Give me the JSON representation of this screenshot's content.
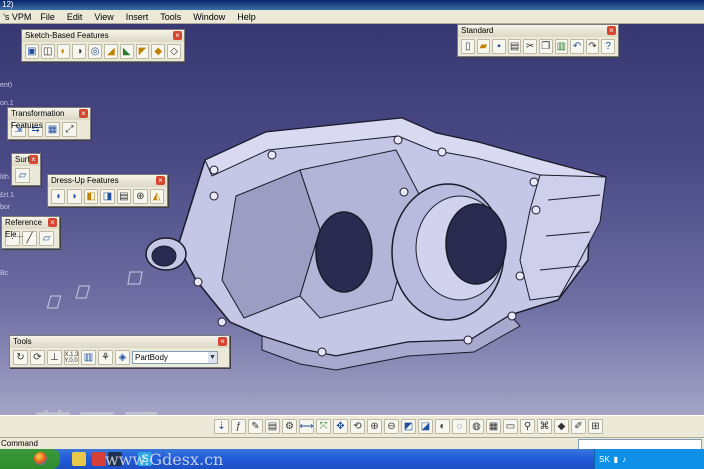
{
  "window": {
    "title_fragment": "12)",
    "app_menu": "’s VPM"
  },
  "menu": [
    "File",
    "Edit",
    "View",
    "Insert",
    "Tools",
    "Window",
    "Help"
  ],
  "toolbars": {
    "sketch": {
      "title": "Sketch-Based Features",
      "icons": [
        "pad-icon",
        "pocket-icon",
        "shaft-icon",
        "groove-icon",
        "hole-icon",
        "rib-icon",
        "slot-icon",
        "stiffener-icon",
        "loft-icon",
        "remove-loft-icon"
      ]
    },
    "standard": {
      "title": "Standard",
      "icons": [
        "new-icon",
        "open-icon",
        "save-icon",
        "print-icon",
        "cut-icon",
        "copy-icon",
        "paste-icon",
        "undo-icon",
        "redo-icon",
        "whats-this-icon"
      ]
    },
    "transformation": {
      "title": "Transformation Features",
      "icons": [
        "translation-icon",
        "mirror-icon",
        "pattern-icon",
        "scaling-icon"
      ]
    },
    "surf": {
      "title": "Surf...",
      "icons": [
        "surface-icon"
      ]
    },
    "dressup": {
      "title": "Dress-Up Features",
      "icons": [
        "fillet-icon",
        "chamfer-icon",
        "draft-icon",
        "shell-icon",
        "thickness-icon",
        "thread-icon",
        "remove-face-icon"
      ]
    },
    "reference": {
      "title": "Reference Ele...",
      "icons": [
        "point-icon",
        "line-icon",
        "plane-icon"
      ]
    },
    "tools": {
      "title": "Tools",
      "icons": [
        "update-icon",
        "swap-visu-icon",
        "axis-system-icon",
        "coordinates-icon",
        "catalog-icon",
        "body-icon",
        "set-icon"
      ],
      "coords_label": "X,1,3\nY,0,0",
      "body_select": "PartBody"
    }
  },
  "tree_labels": [
    "ent)",
    "on.1",
    "lith",
    "£rt.1",
    "bor",
    "Bc"
  ],
  "status": {
    "command_label": "Command",
    "sk_label": "SK"
  },
  "watermark": {
    "text": "莫西网",
    "url": "www.Gdesx.cn"
  },
  "colors": {
    "viewport_top": "#34346e",
    "viewport_bottom": "#c8c8dc",
    "part_fill": "#c8c8e8",
    "part_edge": "#1a1a2a",
    "toolbar_bg": "#ece9d8"
  }
}
